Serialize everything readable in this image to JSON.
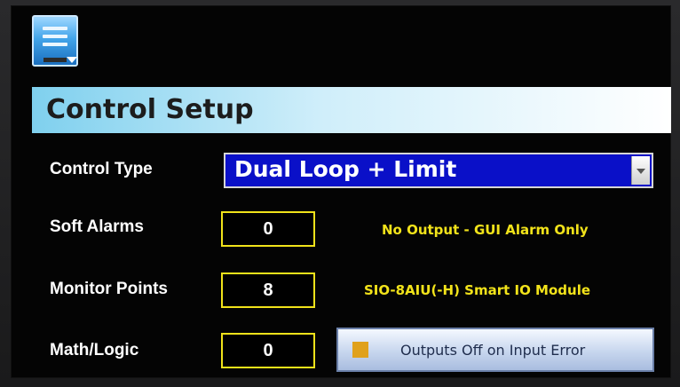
{
  "header": {
    "title": "Control Setup"
  },
  "control_type": {
    "label": "Control Type",
    "value": "Dual Loop + Limit"
  },
  "soft_alarms": {
    "label": "Soft Alarms",
    "value": "0",
    "info": "No Output - GUI Alarm Only"
  },
  "monitor_points": {
    "label": "Monitor Points",
    "value": "8",
    "info": "SIO-8AIU(-H) Smart IO Module"
  },
  "math_logic": {
    "label": "Math/Logic",
    "value": "0"
  },
  "outputs_toggle": {
    "label": "Outputs Off on Input Error",
    "indicator_color": "#e0a11c"
  },
  "colors": {
    "accent_blue": "#0a10c8",
    "highlight_yellow": "#f2e31a",
    "title_bar": "#7fd0ee"
  },
  "icons": {
    "menu": "monitor-menu-icon",
    "dropdown": "chevron-down-icon"
  }
}
